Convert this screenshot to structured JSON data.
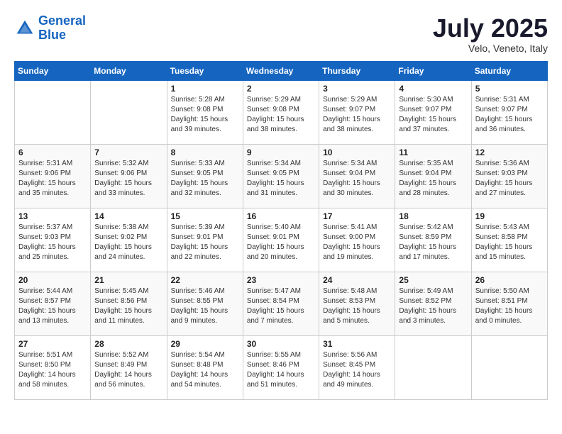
{
  "header": {
    "logo_line1": "General",
    "logo_line2": "Blue",
    "month": "July 2025",
    "location": "Velo, Veneto, Italy"
  },
  "days_of_week": [
    "Sunday",
    "Monday",
    "Tuesday",
    "Wednesday",
    "Thursday",
    "Friday",
    "Saturday"
  ],
  "weeks": [
    [
      {
        "day": "",
        "content": ""
      },
      {
        "day": "",
        "content": ""
      },
      {
        "day": "1",
        "content": "Sunrise: 5:28 AM\nSunset: 9:08 PM\nDaylight: 15 hours\nand 39 minutes."
      },
      {
        "day": "2",
        "content": "Sunrise: 5:29 AM\nSunset: 9:08 PM\nDaylight: 15 hours\nand 38 minutes."
      },
      {
        "day": "3",
        "content": "Sunrise: 5:29 AM\nSunset: 9:07 PM\nDaylight: 15 hours\nand 38 minutes."
      },
      {
        "day": "4",
        "content": "Sunrise: 5:30 AM\nSunset: 9:07 PM\nDaylight: 15 hours\nand 37 minutes."
      },
      {
        "day": "5",
        "content": "Sunrise: 5:31 AM\nSunset: 9:07 PM\nDaylight: 15 hours\nand 36 minutes."
      }
    ],
    [
      {
        "day": "6",
        "content": "Sunrise: 5:31 AM\nSunset: 9:06 PM\nDaylight: 15 hours\nand 35 minutes."
      },
      {
        "day": "7",
        "content": "Sunrise: 5:32 AM\nSunset: 9:06 PM\nDaylight: 15 hours\nand 33 minutes."
      },
      {
        "day": "8",
        "content": "Sunrise: 5:33 AM\nSunset: 9:05 PM\nDaylight: 15 hours\nand 32 minutes."
      },
      {
        "day": "9",
        "content": "Sunrise: 5:34 AM\nSunset: 9:05 PM\nDaylight: 15 hours\nand 31 minutes."
      },
      {
        "day": "10",
        "content": "Sunrise: 5:34 AM\nSunset: 9:04 PM\nDaylight: 15 hours\nand 30 minutes."
      },
      {
        "day": "11",
        "content": "Sunrise: 5:35 AM\nSunset: 9:04 PM\nDaylight: 15 hours\nand 28 minutes."
      },
      {
        "day": "12",
        "content": "Sunrise: 5:36 AM\nSunset: 9:03 PM\nDaylight: 15 hours\nand 27 minutes."
      }
    ],
    [
      {
        "day": "13",
        "content": "Sunrise: 5:37 AM\nSunset: 9:03 PM\nDaylight: 15 hours\nand 25 minutes."
      },
      {
        "day": "14",
        "content": "Sunrise: 5:38 AM\nSunset: 9:02 PM\nDaylight: 15 hours\nand 24 minutes."
      },
      {
        "day": "15",
        "content": "Sunrise: 5:39 AM\nSunset: 9:01 PM\nDaylight: 15 hours\nand 22 minutes."
      },
      {
        "day": "16",
        "content": "Sunrise: 5:40 AM\nSunset: 9:01 PM\nDaylight: 15 hours\nand 20 minutes."
      },
      {
        "day": "17",
        "content": "Sunrise: 5:41 AM\nSunset: 9:00 PM\nDaylight: 15 hours\nand 19 minutes."
      },
      {
        "day": "18",
        "content": "Sunrise: 5:42 AM\nSunset: 8:59 PM\nDaylight: 15 hours\nand 17 minutes."
      },
      {
        "day": "19",
        "content": "Sunrise: 5:43 AM\nSunset: 8:58 PM\nDaylight: 15 hours\nand 15 minutes."
      }
    ],
    [
      {
        "day": "20",
        "content": "Sunrise: 5:44 AM\nSunset: 8:57 PM\nDaylight: 15 hours\nand 13 minutes."
      },
      {
        "day": "21",
        "content": "Sunrise: 5:45 AM\nSunset: 8:56 PM\nDaylight: 15 hours\nand 11 minutes."
      },
      {
        "day": "22",
        "content": "Sunrise: 5:46 AM\nSunset: 8:55 PM\nDaylight: 15 hours\nand 9 minutes."
      },
      {
        "day": "23",
        "content": "Sunrise: 5:47 AM\nSunset: 8:54 PM\nDaylight: 15 hours\nand 7 minutes."
      },
      {
        "day": "24",
        "content": "Sunrise: 5:48 AM\nSunset: 8:53 PM\nDaylight: 15 hours\nand 5 minutes."
      },
      {
        "day": "25",
        "content": "Sunrise: 5:49 AM\nSunset: 8:52 PM\nDaylight: 15 hours\nand 3 minutes."
      },
      {
        "day": "26",
        "content": "Sunrise: 5:50 AM\nSunset: 8:51 PM\nDaylight: 15 hours\nand 0 minutes."
      }
    ],
    [
      {
        "day": "27",
        "content": "Sunrise: 5:51 AM\nSunset: 8:50 PM\nDaylight: 14 hours\nand 58 minutes."
      },
      {
        "day": "28",
        "content": "Sunrise: 5:52 AM\nSunset: 8:49 PM\nDaylight: 14 hours\nand 56 minutes."
      },
      {
        "day": "29",
        "content": "Sunrise: 5:54 AM\nSunset: 8:48 PM\nDaylight: 14 hours\nand 54 minutes."
      },
      {
        "day": "30",
        "content": "Sunrise: 5:55 AM\nSunset: 8:46 PM\nDaylight: 14 hours\nand 51 minutes."
      },
      {
        "day": "31",
        "content": "Sunrise: 5:56 AM\nSunset: 8:45 PM\nDaylight: 14 hours\nand 49 minutes."
      },
      {
        "day": "",
        "content": ""
      },
      {
        "day": "",
        "content": ""
      }
    ]
  ]
}
